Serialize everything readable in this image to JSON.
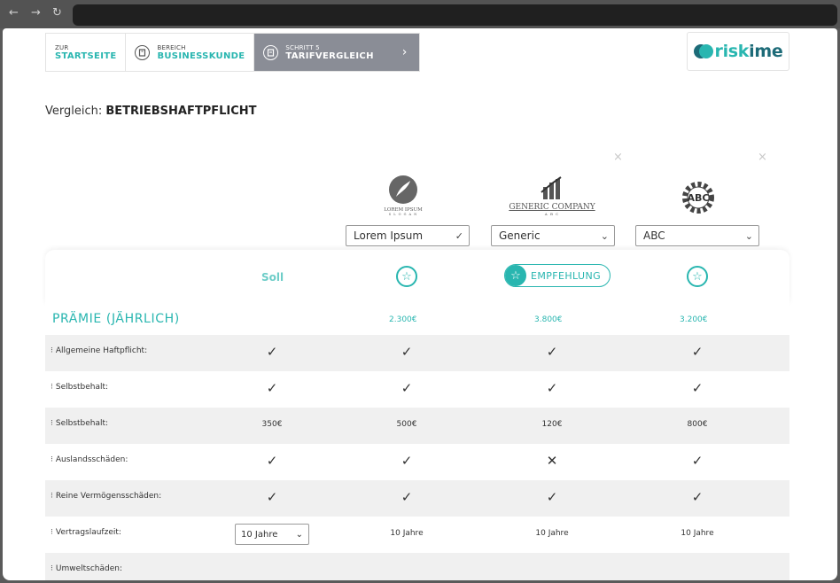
{
  "browser": {
    "back_glyph": "←",
    "forward_glyph": "→",
    "reload_glyph": "↻"
  },
  "breadcrumb": {
    "items": [
      {
        "small": "ZUR",
        "big": "STARTSEITE"
      },
      {
        "small": "BEREICH",
        "big": "BUSINESSKUNDE",
        "icon": "building-icon"
      },
      {
        "small": "SCHRITT 5",
        "big": "TARIFVERGLEICH",
        "icon": "document-icon"
      }
    ],
    "chevron": "›"
  },
  "brand": {
    "name_a": "risk",
    "name_b": "i",
    "name_c": "me"
  },
  "heading": {
    "prefix": "Vergleich: ",
    "value": "BETRIEBSHAFTPFLICHT"
  },
  "companies": [
    {
      "logo_line1": "LOREM IPSUM",
      "logo_line2": "S L O G A N",
      "select": "Lorem Ipsum",
      "arrow": "✓"
    },
    {
      "logo_line1": "GENERIC COMPANY",
      "logo_line2": "A B C",
      "select": "Generic",
      "arrow": "⌄"
    },
    {
      "logo_line1": "ABC",
      "select": "ABC",
      "arrow": "⌄"
    }
  ],
  "remove_glyph": "×",
  "table": {
    "soll_label": "Soll",
    "recommendation": "EMPFEHLUNG",
    "star_glyph": "☆",
    "premium": {
      "label": "PRÄMIE (JÄHRLICH)",
      "values": [
        "2.300€",
        "3.800€",
        "3.200€"
      ]
    },
    "rows": [
      {
        "label": "Allgemeine Haftpflicht:",
        "soll": "✓",
        "values": [
          "✓",
          "✓",
          "✓"
        ]
      },
      {
        "label": "Selbstbehalt:",
        "soll": "✓",
        "values": [
          "✓",
          "✓",
          "✓"
        ]
      },
      {
        "label": "Selbstbehalt:",
        "soll": "350€",
        "values": [
          "500€",
          "120€",
          "800€"
        ]
      },
      {
        "label": "Auslandsschäden:",
        "soll": "✓",
        "values": [
          "✓",
          "✕",
          "✓"
        ]
      },
      {
        "label": "Reine Vermögensschäden:",
        "soll": "✓",
        "values": [
          "✓",
          "✓",
          "✓"
        ]
      },
      {
        "label": "Vertragslaufzeit:",
        "soll_select": "10 Jahre",
        "values": [
          "10 Jahre",
          "10 Jahre",
          "10 Jahre"
        ]
      },
      {
        "label": "Umweltschäden:"
      }
    ],
    "row_handle": "⁝"
  },
  "colors": {
    "accent": "#29b6b0",
    "brand_dark": "#1d6b78",
    "active_crumb": "#8a8d96"
  }
}
